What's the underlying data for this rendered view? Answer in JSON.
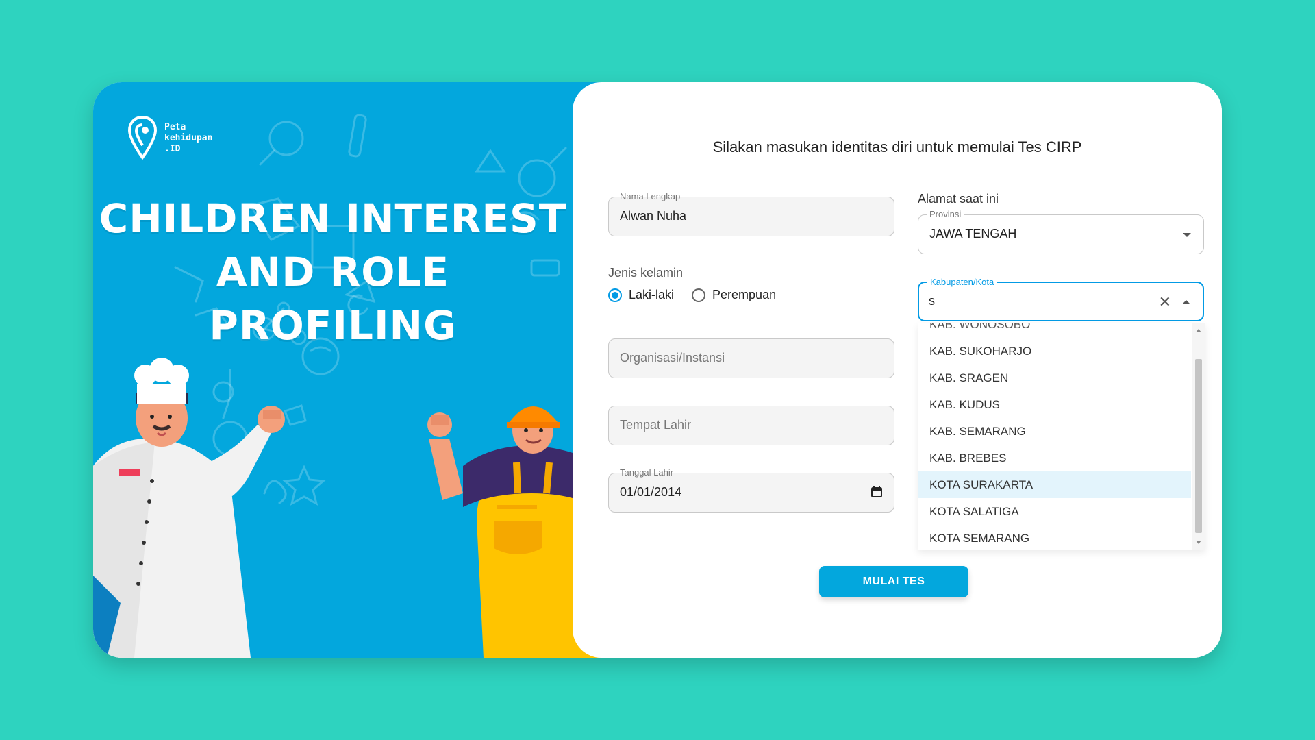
{
  "brand": {
    "logo_text": [
      "Peta",
      "kehidupan",
      ".ID"
    ],
    "hero_title_line1": "CHILDREN INTEREST",
    "hero_title_line2": "AND ROLE PROFILING"
  },
  "form": {
    "title": "Silakan masukan identitas diri untuk memulai Tes CIRP",
    "nama": {
      "label": "Nama Lengkap",
      "value": "Alwan Nuha"
    },
    "gender": {
      "label": "Jenis kelamin",
      "options": [
        {
          "label": "Laki-laki",
          "checked": true
        },
        {
          "label": "Perempuan",
          "checked": false
        }
      ]
    },
    "organisasi": {
      "placeholder": "Organisasi/Instansi"
    },
    "tempat_lahir": {
      "placeholder": "Tempat Lahir"
    },
    "tanggal_lahir": {
      "label": "Tanggal Lahir",
      "value": "01/01/2014"
    },
    "alamat": {
      "label": "Alamat saat ini",
      "provinsi": {
        "label": "Provinsi",
        "value": "JAWA TENGAH"
      },
      "kabupaten": {
        "label": "Kabupaten/Kota",
        "input_value": "s",
        "options_partial_top": "KAB. WONOSOBO",
        "options": [
          "KAB. SUKOHARJO",
          "KAB. SRAGEN",
          "KAB. KUDUS",
          "KAB. SEMARANG",
          "KAB. BREBES",
          "KOTA SURAKARTA",
          "KOTA SALATIGA",
          "KOTA SEMARANG"
        ],
        "highlighted": "KOTA SURAKARTA"
      }
    },
    "submit_label": "MULAI TES"
  },
  "colors": {
    "background": "#2ed3bf",
    "hero": "#03a7dd",
    "accent": "#039be5",
    "button": "#03a7dd"
  },
  "icons": [
    "location-pin-logo-icon",
    "calendar-icon",
    "clear-icon",
    "chevron-up-icon",
    "chevron-down-icon"
  ]
}
